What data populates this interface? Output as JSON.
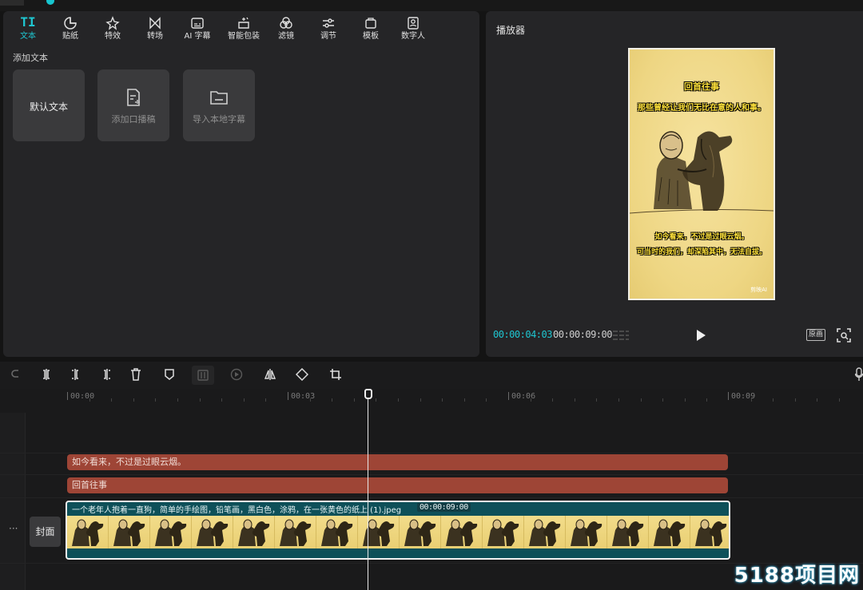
{
  "toolbar": {
    "items": [
      {
        "label": "文本",
        "icon": "text-icon",
        "active": true
      },
      {
        "label": "贴纸",
        "icon": "sticker-icon"
      },
      {
        "label": "特效",
        "icon": "effects-icon"
      },
      {
        "label": "转场",
        "icon": "transition-icon"
      },
      {
        "label": "AI 字幕",
        "icon": "ai-caption-icon"
      },
      {
        "label": "智能包装",
        "icon": "smart-package-icon"
      },
      {
        "label": "滤镜",
        "icon": "filter-icon"
      },
      {
        "label": "调节",
        "icon": "adjust-icon"
      },
      {
        "label": "模板",
        "icon": "template-icon"
      },
      {
        "label": "数字人",
        "icon": "digital-human-icon"
      }
    ],
    "text_glyph": "TI"
  },
  "text_panel": {
    "section_title": "添加文本",
    "cards": [
      "默认文本",
      "添加口播稿",
      "导入本地字幕"
    ]
  },
  "player": {
    "title": "播放器",
    "current_time": "00:00:04:03",
    "total_time": "00:00:09:00",
    "ratio_label": "原画",
    "preview": {
      "title": "回首往事",
      "headline": "那些曾经让我们无比在意的人和事。",
      "caption1": "如今看来，不过是过眼云烟。",
      "caption2": "可当时的我们，却深陷其中，无法自拔。",
      "watermark": "剪映AI"
    }
  },
  "timeline": {
    "ruler_labels": [
      "00:00",
      "00:03",
      "00:06",
      "00:09"
    ],
    "text_clip_1": "如今看来，不过是过眼云烟。",
    "text_clip_2": "回首往事",
    "video_clip_label": "一个老年人抱着一直狗，简单的手绘图，铅笔画，黑白色，涂鸦，在一张黄色的纸上 (1).jpeg",
    "video_clip_duration": "00:00:09:00",
    "cover_label": "封面",
    "more_label": "···"
  },
  "site_watermark": "5188项目网",
  "colors": {
    "accent": "#1fc6d1",
    "text_clip": "#9e4536",
    "video_clip": "#0e5059"
  }
}
